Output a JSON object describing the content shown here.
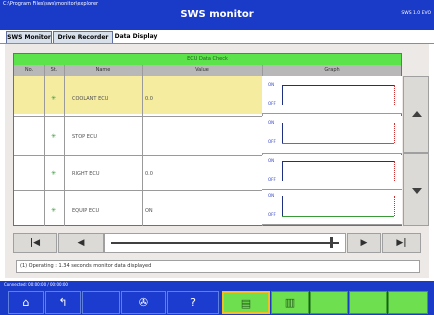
{
  "window": {
    "path": "C:\\Program Files\\sws\\monitor\\explorer",
    "title": "SWS monitor",
    "version": "SWS 1.0 EVO"
  },
  "tabs": [
    {
      "label": "SWS Monitor",
      "active": false
    },
    {
      "label": "Drive Recorder",
      "active": false
    },
    {
      "label": "Data Display",
      "active": true
    }
  ],
  "grid": {
    "group_label": "ECU Data Check",
    "columns": [
      "No.",
      "St.",
      "Name",
      "Value",
      "Graph"
    ],
    "rows": [
      {
        "checked": true,
        "name": "COOLANT ECU",
        "value": "0.0",
        "selected": true,
        "graph_top": "ON",
        "graph_bottom": "OFF"
      },
      {
        "checked": true,
        "name": "STOP ECU",
        "value": "",
        "selected": false,
        "graph_top": "ON",
        "graph_bottom": "OFF"
      },
      {
        "checked": true,
        "name": "RIGHT ECU",
        "value": "0.0",
        "selected": false,
        "graph_top": "ON",
        "graph_bottom": "OFF"
      },
      {
        "checked": true,
        "name": "EQUIP ECU",
        "value": "ON",
        "selected": false,
        "graph_top": "ON",
        "graph_bottom": "OFF"
      }
    ]
  },
  "transport": {
    "first": "|◀",
    "prev": "◀",
    "next": "▶",
    "last": "▶|",
    "position": 0.97
  },
  "status": {
    "message": "(1) Operating : 1.34 seconds monitor data displayed"
  },
  "footer": {
    "info": "Connected: 00:00:00 / 00:00:00"
  },
  "bottom_buttons": [
    {
      "icon": "home-icon",
      "glyph": "⌂"
    },
    {
      "icon": "back-icon",
      "glyph": "↰"
    },
    {
      "icon": "settings-icon",
      "glyph": "✇"
    },
    {
      "icon": "help-icon",
      "glyph": "?"
    },
    {
      "icon": "graph-icon",
      "glyph": "▤"
    },
    {
      "icon": "list-icon",
      "glyph": "▥"
    }
  ],
  "colors": {
    "titlebar": "#1a3ac8",
    "group_header": "#5ce24a",
    "selected_row": "#f5eca0"
  }
}
